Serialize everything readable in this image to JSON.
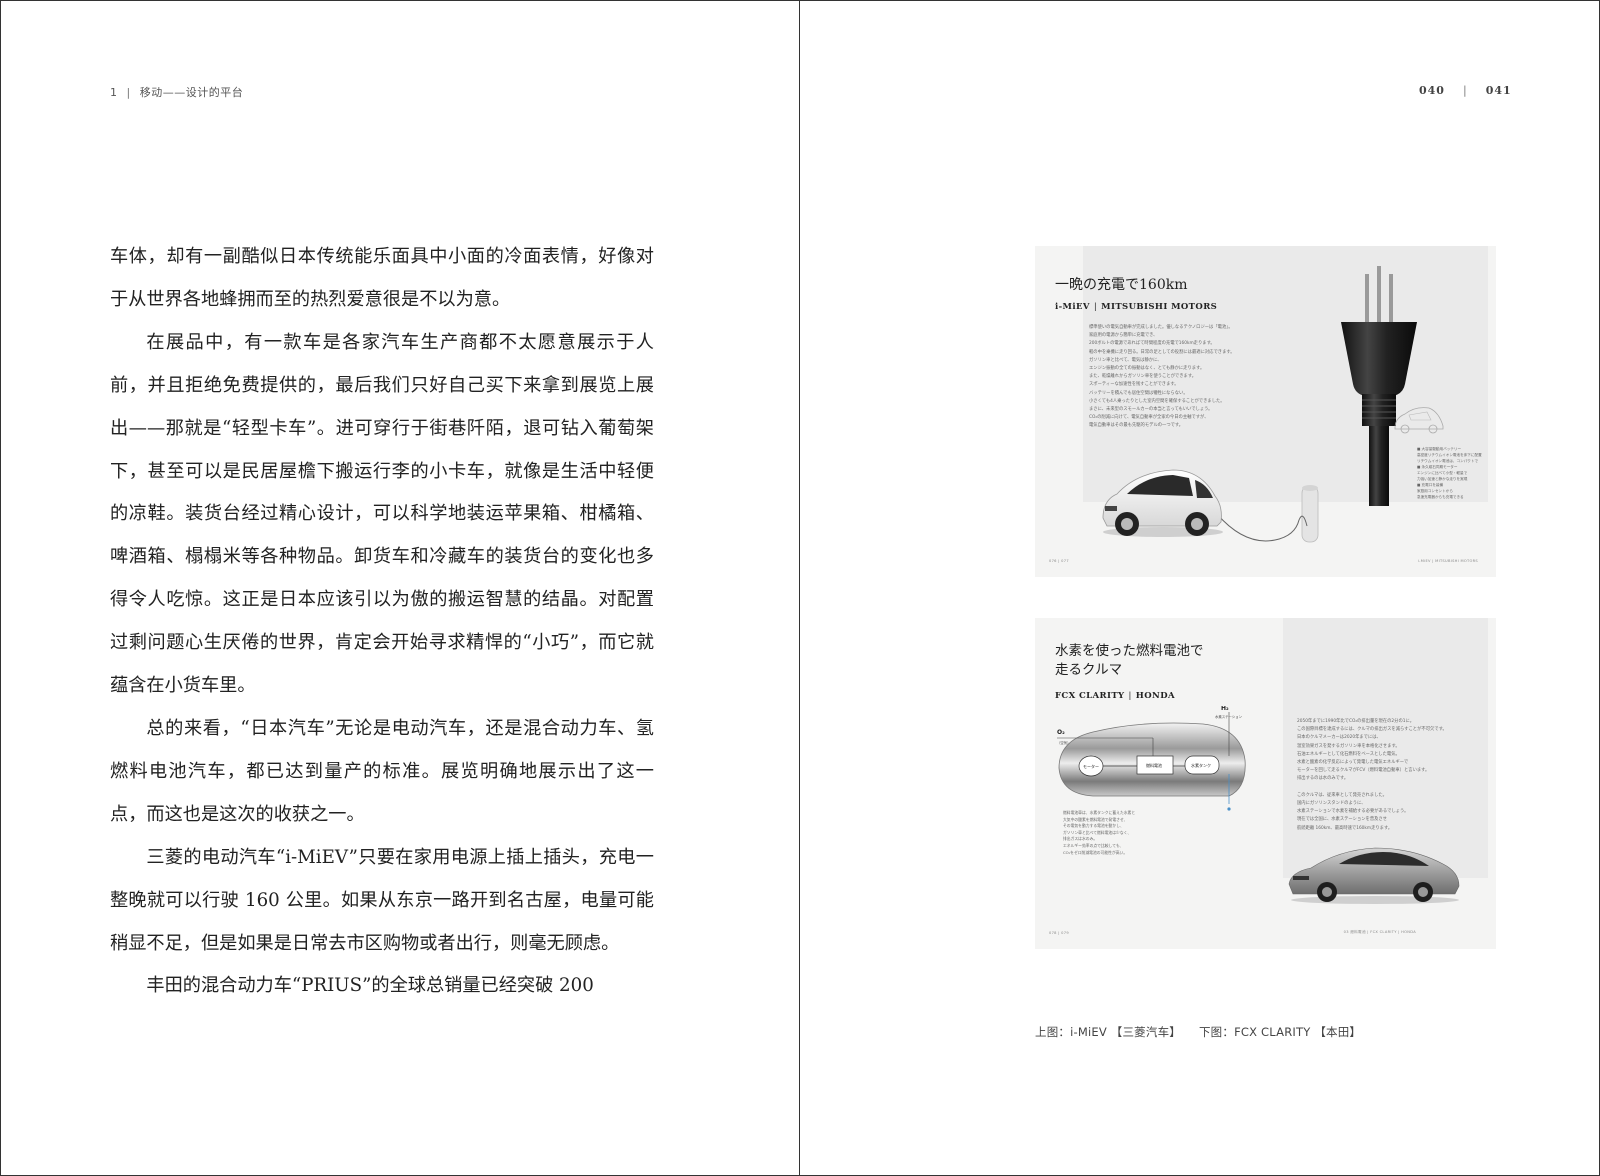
{
  "left_page": {
    "page_number": "1",
    "chapter_title": "移动——设计的平台",
    "paragraphs": [
      "车体，却有一副酷似日本传统能乐面具中小面的冷面表情，好像对于从世界各地蜂拥而至的热烈爱意很是不以为意。",
      "在展品中，有一款车是各家汽车生产商都不太愿意展示于人前，并且拒绝免费提供的，最后我们只好自己买下来拿到展览上展出——那就是“轻型卡车”。进可穿行于街巷阡陌，退可钻入葡萄架下，甚至可以是民居屋檐下搬运行李的小卡车，就像是生活中轻便的凉鞋。装货台经过精心设计，可以科学地装运苹果箱、柑橘箱、啤酒箱、榻榻米等各种物品。卸货车和冷藏车的装货台的变化也多得令人吃惊。这正是日本应该引以为傲的搬运智慧的结晶。对配置过剩问题心生厌倦的世界，肯定会开始寻求精悍的“小巧”，而它就蕴含在小货车里。",
      "总的来看，“日本汽车”无论是电动汽车，还是混合动力车、氢燃料电池汽车，都已达到量产的标准。展览明确地展示出了这一点，而这也是这次的收获之一。",
      "三菱的电动汽车“i-MiEV”只要在家用电源上插上插头，充电一整晚就可以行驶 160 公里。如果从东京一路开到名古屋，电量可能稍显不足，但是如果是日常去市区购物或者出行，则毫无顾虑。",
      "丰田的混合动力车“PRIUS”的全球总销量已经突破 200"
    ]
  },
  "right_page": {
    "page_numbers": [
      "040",
      "041"
    ],
    "figure_top": {
      "title": "一晩の充電で160km",
      "model": "i-MiEV",
      "maker": "MITSUBISHI MOTORS",
      "body": "標準使いの電気自動車が完成しました。優しなるテクノロジーは「電池」。\n家庭用の電源から簡単に充電でき、\n200ボルトの電源であればて時間程度の充電で160km走ります。\n軽の中を乗機に走り回る。日常の足としての役割には最適に対応できます。\nガソリン車と比べて、電気は静かに、\nエンジン振動の全ての振動はなく、とても静かに走ります。\nまた、乾燥離れからガソリン車を使うことができます。\nスポーティーな加速性を残すことができます。\nバッテリーを積んでも居住空間は犠牲にならない。\n小さくても4人乗ったりとした室内空間を確保することができました。\nまさに、未来型のスモールカーの本当と言ってもいいでしょう。\nCO₂の削減に向けて、電気自動車が全家の今日の主軸ですが、\n電気自動車はその最も先駆的モデルの一つです。",
      "side_notes": "■ 大容量駆動用バッテリー\n高密度リチウムイオン電池を床下に配置\nリチウムイオン電池は、コンパクトで\n■ 永久磁石同期モーター\nエンジンに比べて小型・軽量で\n力強い加速と静かな走りを実現\n■ 充電口を装備\n家庭用コンセントから\n急速充電器からも充電できる",
      "footer_left": "076 | 077",
      "footer_right": "i-MiEV | MITSUBISHI MOTORS"
    },
    "figure_bottom": {
      "title_lines": [
        "水素を使った燃料電池で",
        "走るクルマ"
      ],
      "model": "FCX CLARITY",
      "maker": "HONDA",
      "body": "2050年までに1990年比でCO₂の排出量を現在の2分の1に。\nこの国際目標を達成するには、クルマの排出ガスを減らすことが不可欠です。\n日本のクルマメーカーは2020年までには、\n温室効果ガスを発するガソリン車を本格化させます。\n石油エネルギーとして化石燃料をベースとした電気。\n水素と酸素の化学反応によって発電した電気エネルギーで\nモーターを回して走るクルマがFCV（燃料電池自動車）と言います。\n排出するのは水のみです。\n\nこのクルマは、従来車として発売されました。\n国内にガソリンスタンドのように、\n水素ステーションで水素を補給する必要があるでしょう。\n現在では全国に、水素ステーションを普及させ\n航続距離 160km、最高時速で160km走ります。",
      "diagram_labels": {
        "h2": "H₂",
        "h2_station": "水素ステーション",
        "o2": "O₂",
        "o2_air": "（空気）",
        "motor": "モーター",
        "fuel_cell": "燃料電池",
        "h2_tank": "水素タンク"
      },
      "diagram_note": "燃料電池車は、水素タンクに蓄えた水素と\n大気中の酸素を燃料電池で発電させ、\nその電気を動力する電池を動かし、\nガソリン車と比べて燃料電池は少なく、\n排出ガスは水のみ。\nエネルギー効率の点で比較しても、\nCO₂をゼロ削減電池の可能性が高い。",
      "footer_left": "078 | 079",
      "footer_right": "03 燃料電池 | FCX CLARITY | HONDA"
    },
    "caption": {
      "top_label": "上图：i-MiEV",
      "top_maker": "【三菱汽车】",
      "bottom_label": "下图：FCX CLARITY",
      "bottom_maker": "【本田】"
    }
  }
}
